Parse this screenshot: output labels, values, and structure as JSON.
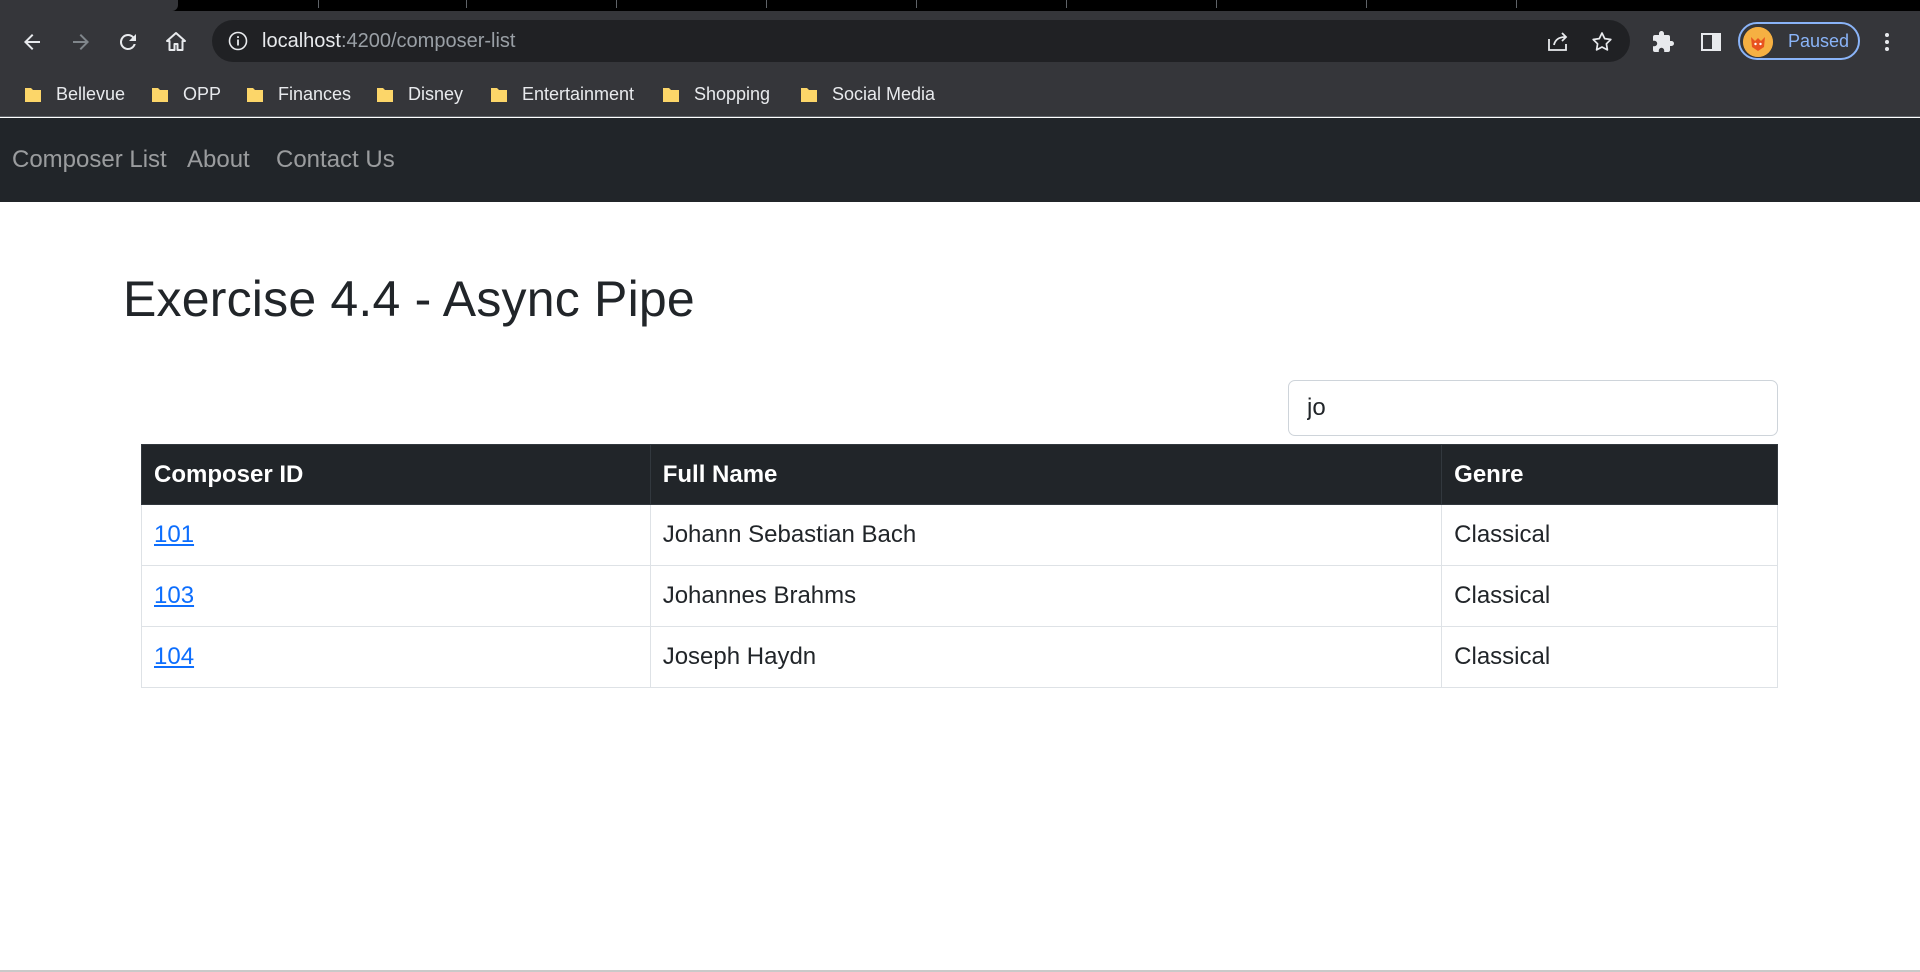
{
  "browser": {
    "address_host": "localhost",
    "address_path": ":4200/composer-list",
    "profile_label": "Paused",
    "accent_color": "#8ab4f8",
    "bookmarks": [
      "Bellevue",
      "OPP",
      "Finances",
      "Disney",
      "Entertainment",
      "Shopping",
      "Social Media"
    ]
  },
  "navbar": {
    "links": [
      "Composer List",
      "About",
      "Contact Us"
    ]
  },
  "main": {
    "title": "Exercise 4.4 - Async Pipe",
    "search_value": "jo",
    "table": {
      "headers": [
        "Composer ID",
        "Full Name",
        "Genre"
      ],
      "rows": [
        {
          "id": "101",
          "full_name": "Johann Sebastian Bach",
          "genre": "Classical"
        },
        {
          "id": "103",
          "full_name": "Johannes Brahms",
          "genre": "Classical"
        },
        {
          "id": "104",
          "full_name": "Joseph Haydn",
          "genre": "Classical"
        }
      ]
    }
  }
}
